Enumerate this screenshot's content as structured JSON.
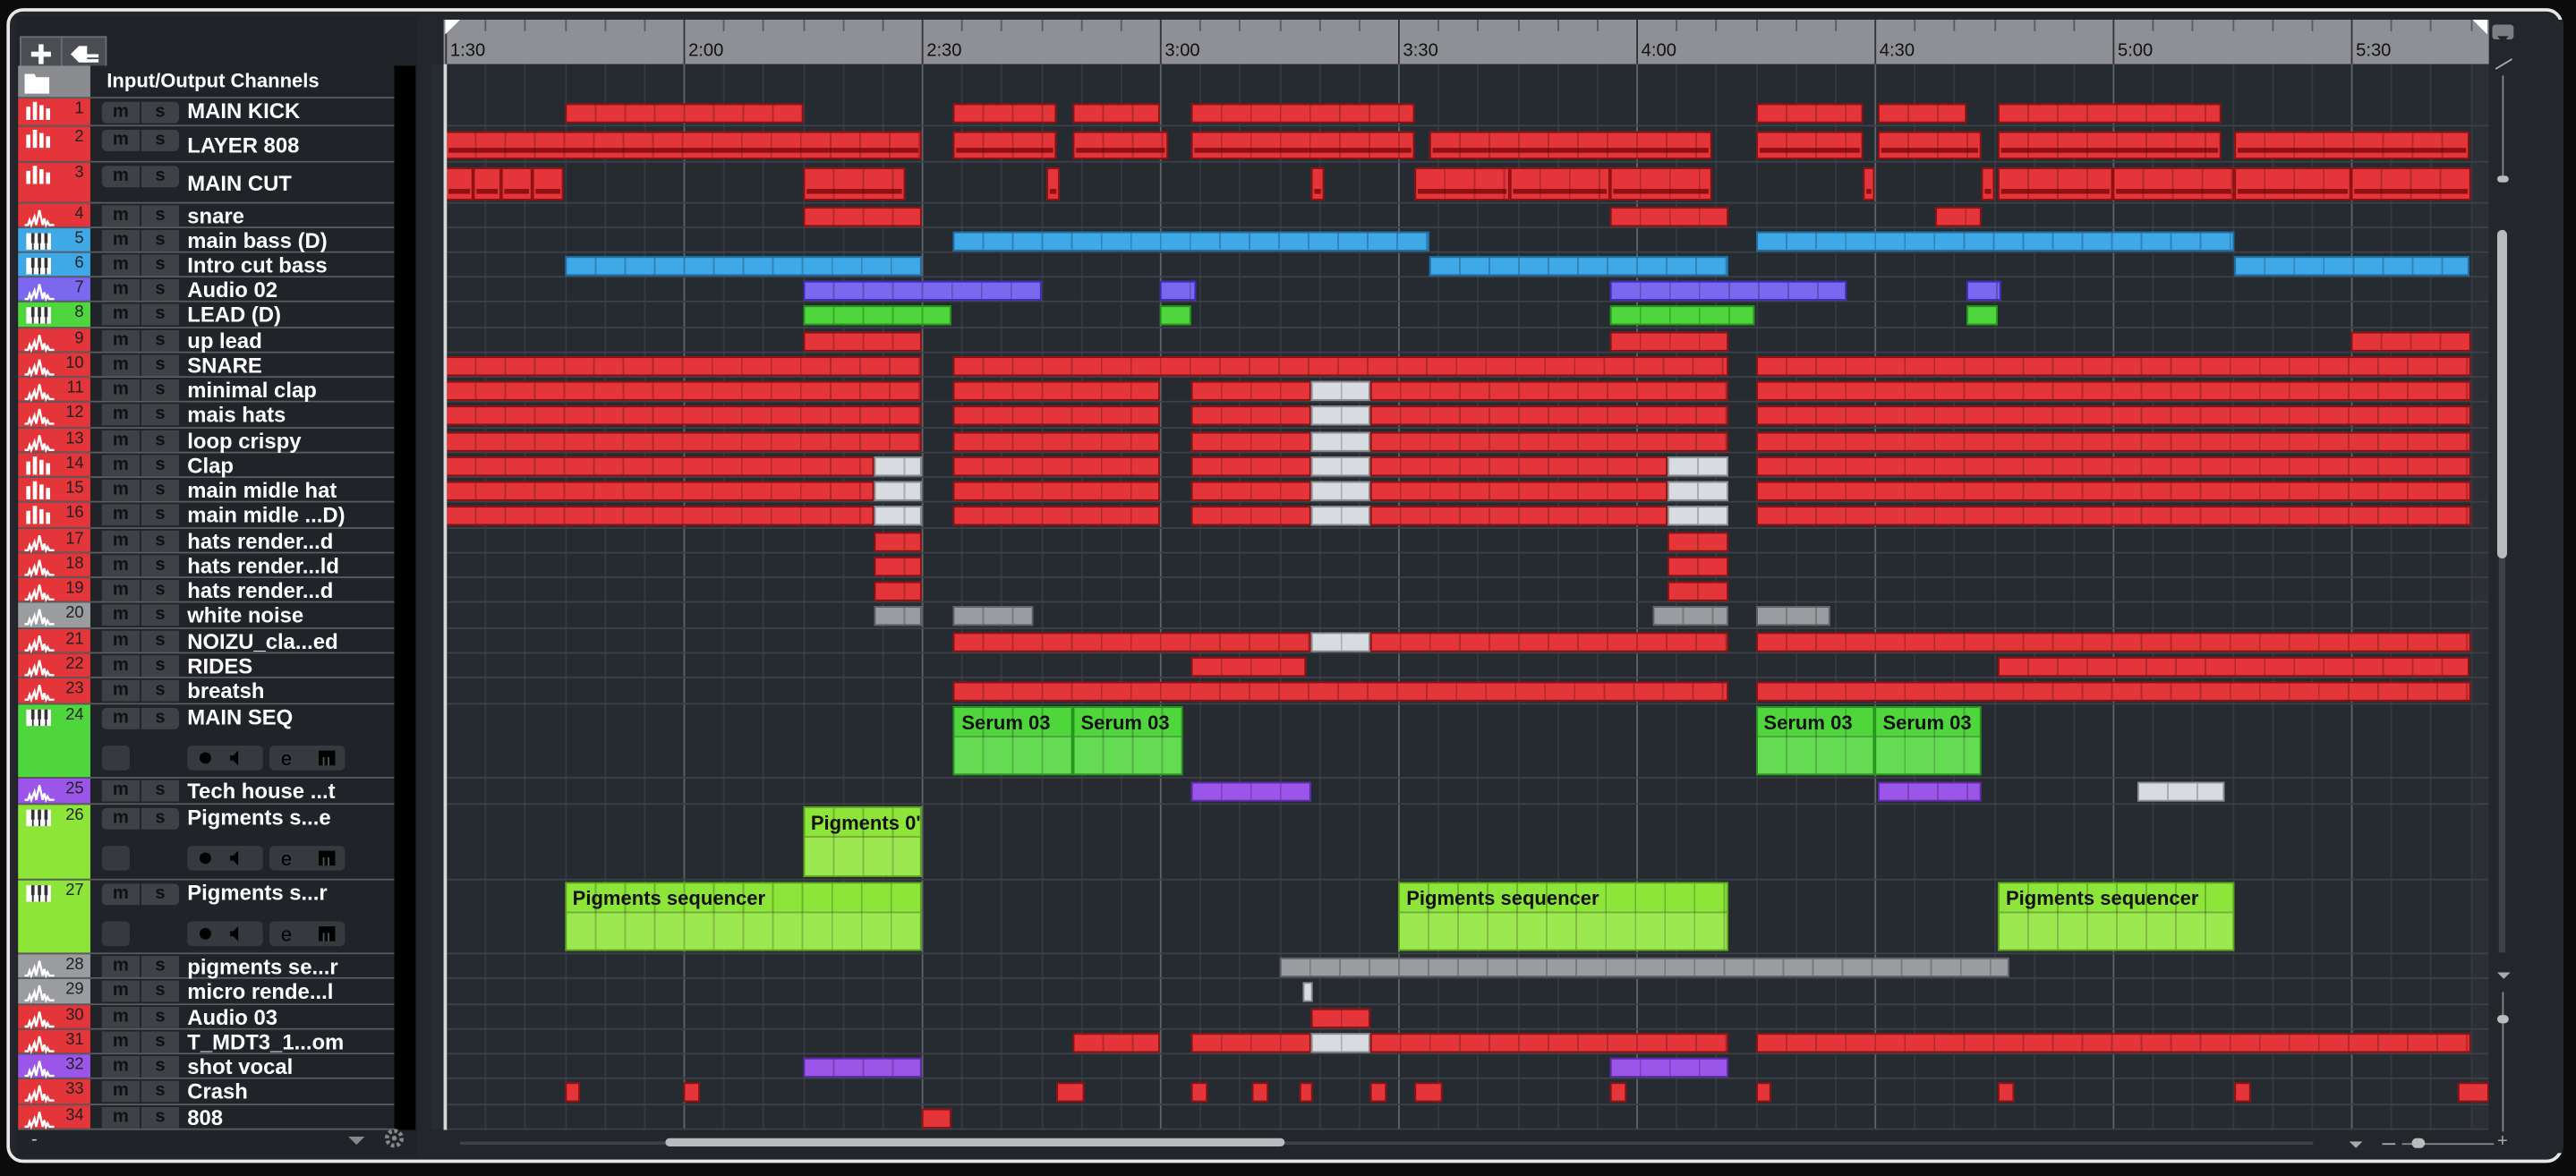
{
  "colors": {
    "red": "#e4363a",
    "blue": "#3fa9e8",
    "purple": "#7b68ee",
    "violet": "#9b55e8",
    "green": "#4fd63c",
    "lime": "#8ee53a",
    "gray": "#9a9c9f",
    "white": "#d8dce0",
    "bg": "#23262b"
  },
  "toolbar": {
    "add_icon": "plus-icon",
    "preset_icon": "track-preset-icon"
  },
  "io_row": {
    "label": "Input/Output Channels",
    "icon": "folder-icon"
  },
  "mute_label": "m",
  "solo_label": "s",
  "ruler": {
    "labels": [
      "1:30",
      "2:00",
      "2:30",
      "3:00",
      "3:30",
      "4:00",
      "4:30",
      "5:00",
      "5:30"
    ],
    "view_start_seconds": 89.5,
    "project_end_seconds": 345
  },
  "tracks": [
    {
      "num": "1",
      "name": "MAIN KICK",
      "color": "red",
      "type": "drum",
      "clips": [
        {
          "s": 105,
          "e": 135
        },
        {
          "s": 154,
          "e": 167
        },
        {
          "s": 169,
          "e": 180
        },
        {
          "s": 184,
          "e": 212
        },
        {
          "s": 255,
          "e": 268.5
        },
        {
          "s": 270.5,
          "e": 281.6
        },
        {
          "s": 285.5,
          "e": 313.7
        }
      ]
    },
    {
      "num": "2",
      "name": "LAYER 808",
      "color": "red",
      "type": "drum",
      "stripe": true,
      "clips": [
        {
          "s": 90,
          "e": 150
        },
        {
          "s": 154,
          "e": 167
        },
        {
          "s": 169,
          "e": 181
        },
        {
          "s": 184,
          "e": 212
        },
        {
          "s": 214,
          "e": 249.5
        },
        {
          "s": 255,
          "e": 268.5
        },
        {
          "s": 270.5,
          "e": 283.5
        },
        {
          "s": 285.5,
          "e": 313.7
        },
        {
          "s": 315.3,
          "e": 345
        }
      ]
    },
    {
      "num": "3",
      "name": "MAIN CUT",
      "color": "red",
      "type": "drum",
      "stripe": true,
      "clips": [
        {
          "s": 90,
          "e": 93.5
        },
        {
          "s": 93.5,
          "e": 97
        },
        {
          "s": 97,
          "e": 101
        },
        {
          "s": 101,
          "e": 105
        },
        {
          "s": 135,
          "e": 148
        },
        {
          "s": 165.8,
          "e": 167.4
        },
        {
          "s": 199,
          "e": 200.6
        },
        {
          "s": 212,
          "e": 224
        },
        {
          "s": 224,
          "e": 236.7
        },
        {
          "s": 236.7,
          "e": 249.5
        },
        {
          "s": 268.5,
          "e": 270
        },
        {
          "s": 283.5,
          "e": 285
        },
        {
          "s": 285.5,
          "e": 300
        },
        {
          "s": 300,
          "e": 315.3
        },
        {
          "s": 315.3,
          "e": 330
        },
        {
          "s": 330,
          "e": 345
        }
      ]
    },
    {
      "num": "4",
      "name": "snare",
      "color": "red",
      "type": "audio",
      "clips": [
        {
          "s": 135,
          "e": 150
        },
        {
          "s": 236.7,
          "e": 251.6
        },
        {
          "s": 277.7,
          "e": 283.5
        }
      ]
    },
    {
      "num": "5",
      "name": "main bass  (D)",
      "color": "blue",
      "type": "instrument",
      "clips": [
        {
          "s": 154,
          "e": 214
        },
        {
          "s": 255,
          "e": 315.3
        }
      ]
    },
    {
      "num": "6",
      "name": "Intro cut bass",
      "color": "blue",
      "type": "instrument",
      "clips": [
        {
          "s": 105,
          "e": 150
        },
        {
          "s": 214,
          "e": 251.6
        },
        {
          "s": 315.3,
          "e": 345
        }
      ]
    },
    {
      "num": "7",
      "name": "Audio 02",
      "color": "purple",
      "type": "audio",
      "clips": [
        {
          "s": 135,
          "e": 165
        },
        {
          "s": 180,
          "e": 184.5
        },
        {
          "s": 236.7,
          "e": 266.5
        },
        {
          "s": 281.6,
          "e": 286
        }
      ]
    },
    {
      "num": "8",
      "name": "LEAD  (D)",
      "color": "green",
      "type": "instrument",
      "clips": [
        {
          "s": 135,
          "e": 153.7
        },
        {
          "s": 180,
          "e": 184
        },
        {
          "s": 236.7,
          "e": 255
        },
        {
          "s": 281.6,
          "e": 285.5
        }
      ]
    },
    {
      "num": "9",
      "name": "up lead",
      "color": "red",
      "type": "audio",
      "clips": [
        {
          "s": 135,
          "e": 150
        },
        {
          "s": 236.7,
          "e": 251.6
        },
        {
          "s": 330,
          "e": 345
        }
      ]
    },
    {
      "num": "10",
      "name": "SNARE",
      "color": "red",
      "type": "audio",
      "clips": [
        {
          "s": 90,
          "e": 150
        },
        {
          "s": 154,
          "e": 251.6
        },
        {
          "s": 255,
          "e": 345
        }
      ]
    },
    {
      "num": "11",
      "name": "minimal clap",
      "color": "red",
      "type": "audio",
      "clips": [
        {
          "s": 90,
          "e": 150
        },
        {
          "s": 154,
          "e": 180
        },
        {
          "s": 184,
          "e": 199
        },
        {
          "s": 199,
          "e": 206.5,
          "c": "white"
        },
        {
          "s": 206.5,
          "e": 251.6
        },
        {
          "s": 255,
          "e": 345
        }
      ]
    },
    {
      "num": "12",
      "name": "mais hats",
      "color": "red",
      "type": "audio",
      "clips": [
        {
          "s": 90,
          "e": 150
        },
        {
          "s": 154,
          "e": 180
        },
        {
          "s": 184,
          "e": 199
        },
        {
          "s": 199,
          "e": 206.5,
          "c": "white"
        },
        {
          "s": 206.5,
          "e": 251.6
        },
        {
          "s": 255,
          "e": 345
        }
      ]
    },
    {
      "num": "13",
      "name": "loop crispy",
      "color": "red",
      "type": "audio",
      "clips": [
        {
          "s": 90,
          "e": 150
        },
        {
          "s": 154,
          "e": 180
        },
        {
          "s": 184,
          "e": 199
        },
        {
          "s": 199,
          "e": 206.5,
          "c": "white"
        },
        {
          "s": 206.5,
          "e": 251.6
        },
        {
          "s": 255,
          "e": 345
        }
      ]
    },
    {
      "num": "14",
      "name": "Clap",
      "color": "red",
      "type": "drum",
      "clips": [
        {
          "s": 90,
          "e": 144
        },
        {
          "s": 144,
          "e": 150,
          "c": "white"
        },
        {
          "s": 154,
          "e": 180
        },
        {
          "s": 184,
          "e": 199
        },
        {
          "s": 199,
          "e": 206.5,
          "c": "white"
        },
        {
          "s": 206.5,
          "e": 244
        },
        {
          "s": 244,
          "e": 251.6,
          "c": "white"
        },
        {
          "s": 255,
          "e": 345
        }
      ]
    },
    {
      "num": "15",
      "name": "main midle hat",
      "color": "red",
      "type": "drum",
      "clips": [
        {
          "s": 90,
          "e": 144
        },
        {
          "s": 144,
          "e": 150,
          "c": "white"
        },
        {
          "s": 154,
          "e": 180
        },
        {
          "s": 184,
          "e": 199
        },
        {
          "s": 199,
          "e": 206.5,
          "c": "white"
        },
        {
          "s": 206.5,
          "e": 244
        },
        {
          "s": 244,
          "e": 251.6,
          "c": "white"
        },
        {
          "s": 255,
          "e": 345
        }
      ]
    },
    {
      "num": "16",
      "name": "main midle ...D)",
      "color": "red",
      "type": "drum",
      "clips": [
        {
          "s": 90,
          "e": 144
        },
        {
          "s": 144,
          "e": 150,
          "c": "white"
        },
        {
          "s": 154,
          "e": 180
        },
        {
          "s": 184,
          "e": 199
        },
        {
          "s": 199,
          "e": 206.5,
          "c": "white"
        },
        {
          "s": 206.5,
          "e": 244
        },
        {
          "s": 244,
          "e": 251.6,
          "c": "white"
        },
        {
          "s": 255,
          "e": 345
        }
      ]
    },
    {
      "num": "17",
      "name": "hats render...d",
      "color": "red",
      "type": "audio",
      "clips": [
        {
          "s": 144,
          "e": 150
        },
        {
          "s": 244,
          "e": 251.6
        }
      ]
    },
    {
      "num": "18",
      "name": "hats render...ld",
      "color": "red",
      "type": "audio",
      "clips": [
        {
          "s": 144,
          "e": 150
        },
        {
          "s": 244,
          "e": 251.6
        }
      ]
    },
    {
      "num": "19",
      "name": "hats render...d",
      "color": "red",
      "type": "audio",
      "clips": [
        {
          "s": 144,
          "e": 150
        },
        {
          "s": 244,
          "e": 251.6
        }
      ]
    },
    {
      "num": "20",
      "name": "white noise",
      "color": "gray",
      "type": "audio",
      "clips": [
        {
          "s": 144,
          "e": 150
        },
        {
          "s": 154,
          "e": 164
        },
        {
          "s": 242,
          "e": 251.6
        },
        {
          "s": 255,
          "e": 264.5
        }
      ]
    },
    {
      "num": "21",
      "name": "NOIZU_cla...ed",
      "color": "red",
      "type": "audio",
      "clips": [
        {
          "s": 154,
          "e": 199
        },
        {
          "s": 199,
          "e": 206.5,
          "c": "white"
        },
        {
          "s": 206.5,
          "e": 251.6
        },
        {
          "s": 255,
          "e": 345
        }
      ]
    },
    {
      "num": "22",
      "name": "RIDES",
      "color": "red",
      "type": "audio",
      "clips": [
        {
          "s": 184,
          "e": 198.5
        },
        {
          "s": 285.5,
          "e": 345
        }
      ]
    },
    {
      "num": "23",
      "name": "breatsh",
      "color": "red",
      "type": "audio",
      "clips": [
        {
          "s": 154,
          "e": 251.6
        },
        {
          "s": 255,
          "e": 345
        }
      ]
    },
    {
      "num": "24",
      "name": "MAIN SEQ",
      "color": "green",
      "type": "instrument",
      "tall": true,
      "clips": [
        {
          "s": 154,
          "e": 169,
          "label": "Serum 03"
        },
        {
          "s": 169,
          "e": 183,
          "label": "Serum 03"
        },
        {
          "s": 255,
          "e": 270,
          "label": "Serum 03"
        },
        {
          "s": 270,
          "e": 283.5,
          "label": "Serum 03"
        }
      ]
    },
    {
      "num": "25",
      "name": "Tech house ...t",
      "color": "violet",
      "type": "audio",
      "clips": [
        {
          "s": 184,
          "e": 199
        },
        {
          "s": 270.5,
          "e": 283.5
        },
        {
          "s": 303,
          "e": 314,
          "c": "white"
        }
      ]
    },
    {
      "num": "26",
      "name": "Pigments s...e",
      "color": "lime",
      "type": "instrument",
      "tall": true,
      "clips": [
        {
          "s": 135,
          "e": 150,
          "label": "Pigments 0'"
        }
      ]
    },
    {
      "num": "27",
      "name": "Pigments s...r",
      "color": "lime",
      "type": "instrument",
      "tall": true,
      "clips": [
        {
          "s": 105,
          "e": 150,
          "label": "Pigments sequencer"
        },
        {
          "s": 210,
          "e": 251.6,
          "label": "Pigments sequencer"
        },
        {
          "s": 285.5,
          "e": 315.3,
          "label": "Pigments sequencer"
        }
      ]
    },
    {
      "num": "28",
      "name": "pigments se...r",
      "color": "gray",
      "type": "audio",
      "clips": [
        {
          "s": 195,
          "e": 287
        }
      ]
    },
    {
      "num": "29",
      "name": "micro rende...l",
      "color": "gray",
      "type": "audio",
      "clips": [
        {
          "s": 198,
          "e": 199.2,
          "c": "white"
        }
      ]
    },
    {
      "num": "30",
      "name": "Audio 03",
      "color": "red",
      "type": "audio",
      "clips": [
        {
          "s": 199,
          "e": 206.5
        }
      ]
    },
    {
      "num": "31",
      "name": "T_MDT3_1...om",
      "color": "red",
      "type": "audio",
      "clips": [
        {
          "s": 169,
          "e": 180
        },
        {
          "s": 184,
          "e": 199
        },
        {
          "s": 199,
          "e": 206.5,
          "c": "white"
        },
        {
          "s": 206.5,
          "e": 251.6
        },
        {
          "s": 255,
          "e": 345
        }
      ]
    },
    {
      "num": "32",
      "name": "shot vocal",
      "color": "violet",
      "type": "audio",
      "clips": [
        {
          "s": 135,
          "e": 150
        },
        {
          "s": 236.7,
          "e": 251.6
        }
      ]
    },
    {
      "num": "33",
      "name": "Crash",
      "color": "red",
      "type": "audio",
      "clips": [
        {
          "s": 105,
          "e": 107
        },
        {
          "s": 120,
          "e": 122
        },
        {
          "s": 167,
          "e": 170.5
        },
        {
          "s": 184,
          "e": 186
        },
        {
          "s": 191.6,
          "e": 193.6
        },
        {
          "s": 197.5,
          "e": 199.3
        },
        {
          "s": 206.5,
          "e": 208.5
        },
        {
          "s": 212,
          "e": 215.5
        },
        {
          "s": 236.7,
          "e": 238.7
        },
        {
          "s": 255,
          "e": 257
        },
        {
          "s": 285.5,
          "e": 287.5
        },
        {
          "s": 315.3,
          "e": 317.3
        },
        {
          "s": 343.5,
          "e": 347.4
        }
      ]
    },
    {
      "num": "34",
      "name": "808",
      "color": "red",
      "type": "audio",
      "clips": [
        {
          "s": 150,
          "e": 153.7
        }
      ]
    }
  ]
}
